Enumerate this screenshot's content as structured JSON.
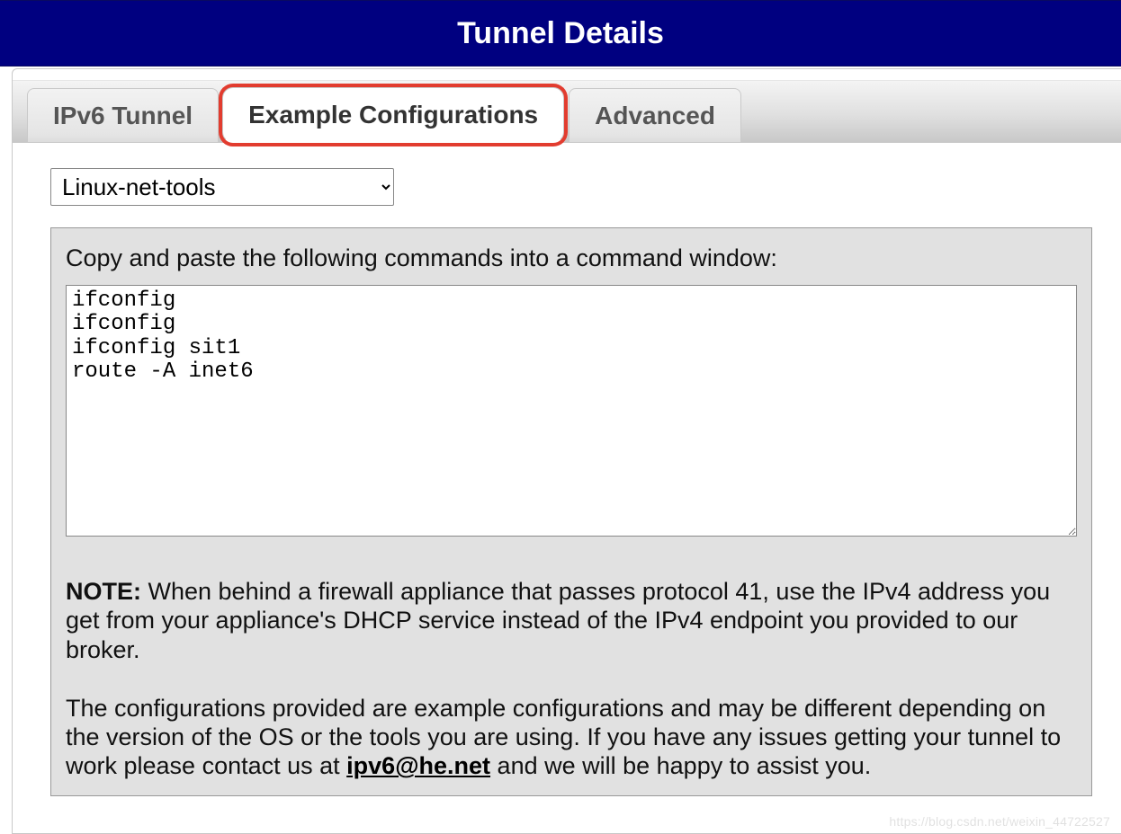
{
  "header": {
    "title": "Tunnel Details"
  },
  "tabs": {
    "ipv6": {
      "label": "IPv6 Tunnel"
    },
    "examples": {
      "label": "Example Configurations"
    },
    "advanced": {
      "label": "Advanced"
    }
  },
  "config": {
    "os_selected": "Linux-net-tools",
    "instruction": "Copy and paste the following commands into a command window:",
    "commands": "ifconfig \nifconfig  \nifconfig sit1 \nroute -A inet6 ",
    "note_label": "NOTE:",
    "note_body_1": " When behind a firewall appliance that passes protocol 41, use the IPv4 address you get from your appliance's DHCP service instead of the IPv4 endpoint you provided to our broker.",
    "note_body_2a": "The configurations provided are example configurations and may be different depending on the version of the OS or the tools you are using. If you have any issues getting your tunnel to work please contact us at ",
    "note_email": "ipv6@he.net",
    "note_body_2b": " and we will be happy to assist you."
  },
  "watermark": "https://blog.csdn.net/weixin_44722527"
}
